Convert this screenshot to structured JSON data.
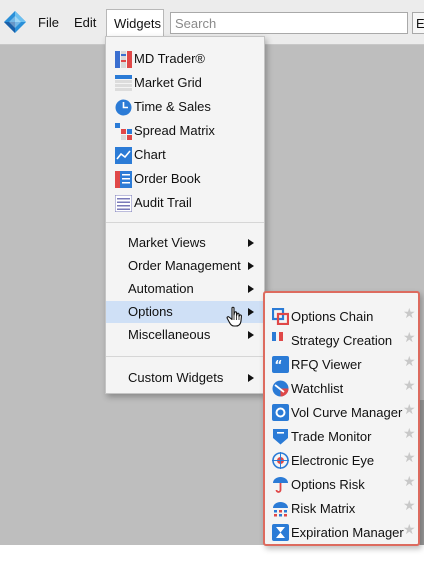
{
  "menubar": {
    "file": "File",
    "edit": "Edit",
    "widgets": "Widgets",
    "extra": "E"
  },
  "search": {
    "placeholder": "Search"
  },
  "widgets_menu": {
    "items": [
      {
        "label": "MD Trader®",
        "icon": "md-trader-icon"
      },
      {
        "label": "Market Grid",
        "icon": "market-grid-icon"
      },
      {
        "label": "Time & Sales",
        "icon": "time-sales-icon"
      },
      {
        "label": "Spread Matrix",
        "icon": "spread-matrix-icon"
      },
      {
        "label": "Chart",
        "icon": "chart-icon"
      },
      {
        "label": "Order Book",
        "icon": "order-book-icon"
      },
      {
        "label": "Audit Trail",
        "icon": "audit-trail-icon"
      }
    ],
    "submenus": [
      {
        "label": "Market Views"
      },
      {
        "label": "Order Management"
      },
      {
        "label": "Automation"
      },
      {
        "label": "Options",
        "highlighted": true
      },
      {
        "label": "Miscellaneous"
      }
    ],
    "custom": {
      "label": "Custom Widgets"
    }
  },
  "options_menu": {
    "items": [
      {
        "label": "Options Chain",
        "icon": "options-chain-icon"
      },
      {
        "label": "Strategy Creation",
        "icon": "strategy-creation-icon"
      },
      {
        "label": "RFQ Viewer",
        "icon": "rfq-viewer-icon"
      },
      {
        "label": "Watchlist",
        "icon": "watchlist-icon"
      },
      {
        "label": "Vol Curve Manager",
        "icon": "vol-curve-manager-icon"
      },
      {
        "label": "Trade Monitor",
        "icon": "trade-monitor-icon"
      },
      {
        "label": "Electronic Eye",
        "icon": "electronic-eye-icon"
      },
      {
        "label": "Options Risk",
        "icon": "options-risk-icon"
      },
      {
        "label": "Risk Matrix",
        "icon": "risk-matrix-icon"
      },
      {
        "label": "Expiration Manager",
        "icon": "expiration-manager-icon"
      }
    ]
  },
  "colors": {
    "accent_blue": "#2b7bd6",
    "highlight": "#cfe0f6",
    "submenu_outline": "#dd6b5f",
    "workspace": "#bebebe"
  }
}
